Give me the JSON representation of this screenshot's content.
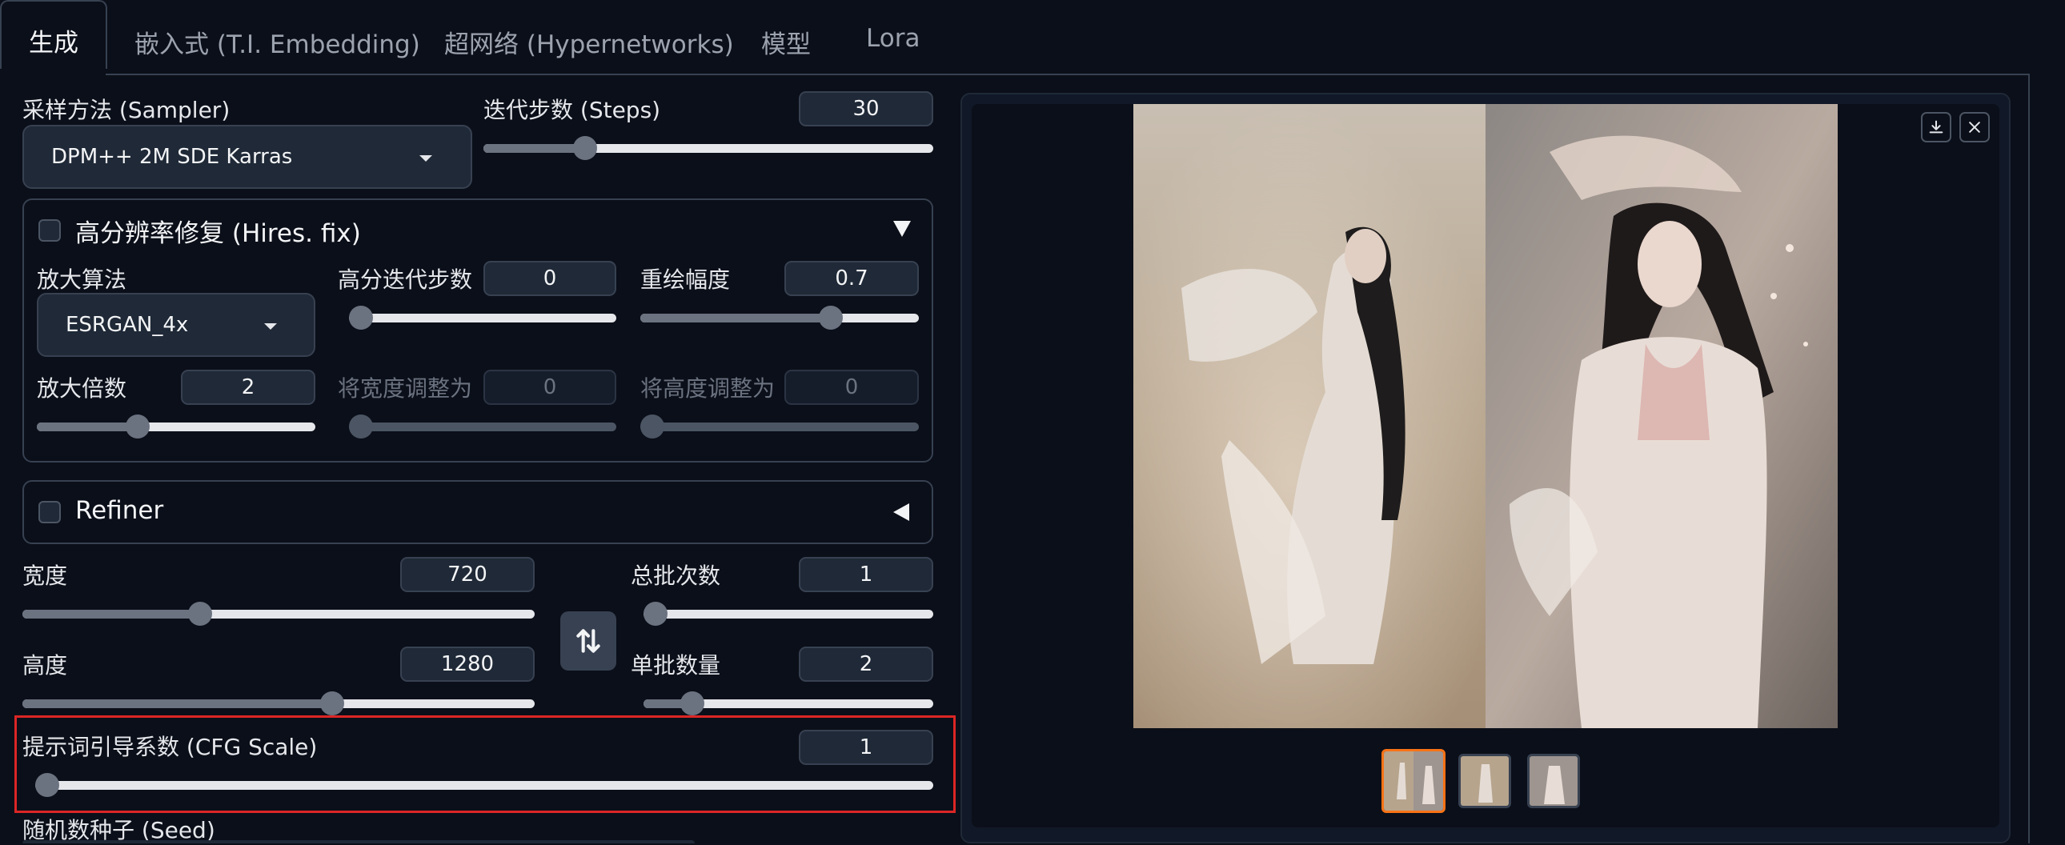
{
  "tabs": [
    {
      "label": "生成",
      "active": true
    },
    {
      "label": "嵌入式 (T.I. Embedding)"
    },
    {
      "label": "超网络 (Hypernetworks)"
    },
    {
      "label": "模型"
    },
    {
      "label": "Lora"
    }
  ],
  "sampler": {
    "label": "采样方法 (Sampler)",
    "value": "DPM++ 2M SDE Karras"
  },
  "steps": {
    "label": "迭代步数 (Steps)",
    "value": "30",
    "fraction": 0.21
  },
  "hires": {
    "title": "高分辨率修复 (Hires. fix)",
    "upscaler_label": "放大算法",
    "upscaler_value": "ESRGAN_4x",
    "hires_steps_label": "高分迭代步数",
    "hires_steps_value": "0",
    "hires_steps_fraction": 0.0,
    "denoise_label": "重绘幅度",
    "denoise_value": "0.7",
    "denoise_fraction": 0.7,
    "scale_label": "放大倍数",
    "scale_value": "2",
    "scale_fraction": 0.35,
    "resize_w_label": "将宽度调整为",
    "resize_w_value": "0",
    "resize_h_label": "将高度调整为",
    "resize_h_value": "0"
  },
  "refiner": {
    "title": "Refiner"
  },
  "width": {
    "label": "宽度",
    "value": "720",
    "fraction": 0.34
  },
  "height": {
    "label": "高度",
    "value": "1280",
    "fraction": 0.61
  },
  "batch_count": {
    "label": "总批次数",
    "value": "1",
    "fraction": 0.0
  },
  "batch_size": {
    "label": "单批数量",
    "value": "2",
    "fraction": 0.14
  },
  "cfg": {
    "label": "提示词引导系数 (CFG Scale)",
    "value": "1",
    "fraction": 0.0
  },
  "seed": {
    "label": "随机数种子 (Seed)"
  },
  "colors": {
    "accent": "#f97316",
    "highlight_border": "#dc2626",
    "bg": "#0b0f19"
  }
}
